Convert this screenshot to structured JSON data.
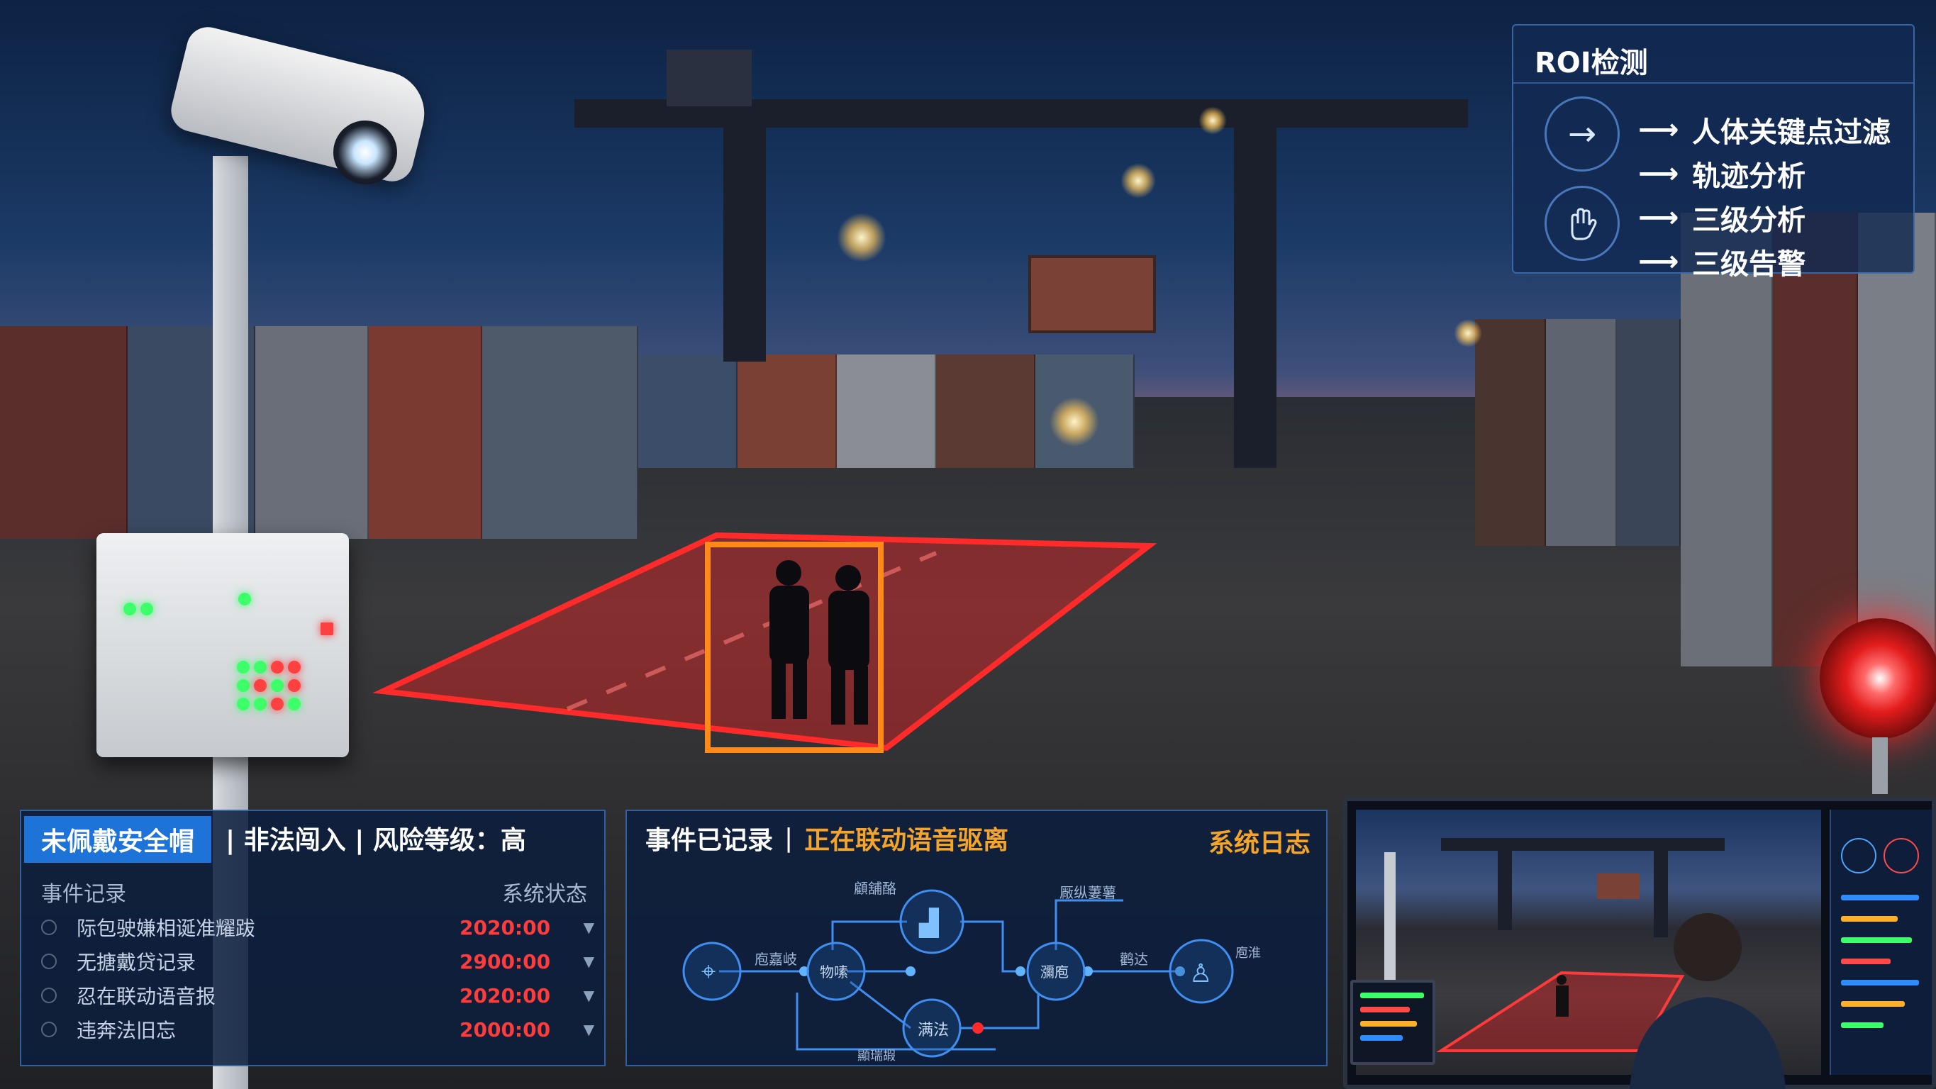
{
  "roi_panel": {
    "title": "ROI检测",
    "items": [
      {
        "label": "人体关键点过滤"
      },
      {
        "label": "轨迹分析"
      },
      {
        "label": "三级分析"
      },
      {
        "label": "三级告警"
      }
    ],
    "icons": [
      "arrow-right-icon",
      "hand-icon"
    ]
  },
  "alert_panel": {
    "tag": "未佩戴安全帽",
    "head_text": "| 非法闯入 | 风险等级：高",
    "columns": {
      "left": "事件记录",
      "right": "系统状态"
    },
    "rows": [
      {
        "label": "际包驶嫌相诞准耀跋",
        "time": "2020:00"
      },
      {
        "label": "无搪戴贷记录",
        "time": "2900:00"
      },
      {
        "label": "忍在联动语音报",
        "time": "2020:00"
      },
      {
        "label": "违奔法旧忘",
        "time": "2000:00"
      }
    ]
  },
  "flow_panel": {
    "head_left": "事件已记录",
    "head_sep": "|",
    "head_active": "正在联动语音驱离",
    "head_log": "系统日志",
    "nodes": {
      "n1_top": "顧舖酪",
      "n2_top": "厰纵萋薯",
      "left": "庖嘉岐",
      "mid_a": "物嗉",
      "mid_b": "瀰庖",
      "mid_c": "鹳达",
      "right_small": "庖淮",
      "bottom": "满法",
      "bottom_label": "顯瑞嘏"
    }
  },
  "colors": {
    "accent": "#1e73d8",
    "alert_red": "#ff3b3b",
    "highlight_orange": "#f4a42a",
    "roi_zone": "#ff2a2a"
  }
}
